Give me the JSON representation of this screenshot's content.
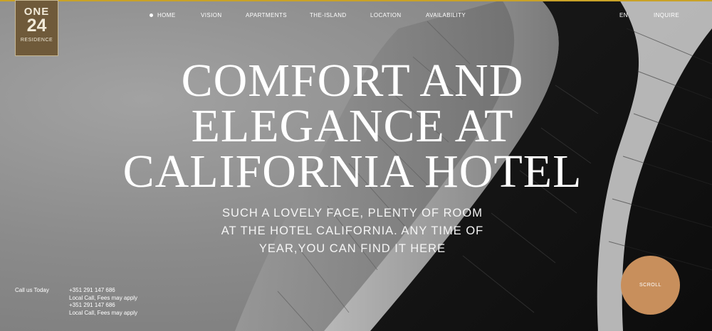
{
  "logo": {
    "line1": "ONE",
    "line2": "24",
    "line3": "RESIDENCE"
  },
  "nav": {
    "home": "HOME",
    "vision": "VISION",
    "apartments": "APARTMENTS",
    "island": "THE-ISLAND",
    "location": "LOCATION",
    "availability": "AVAILABILITY",
    "language": "EN",
    "inquire": "INQUIRE"
  },
  "hero": {
    "title_lines": [
      "COMFORT AND",
      "ELEGANCE AT",
      "CALIFORNIA HOTEL"
    ],
    "subtitle_lines": [
      "SUCH A LOVELY FACE, PLENTY OF ROOM",
      "AT THE HOTEL CALIFORNIA. ANY TIME OF",
      "YEAR,YOU CAN FIND IT HERE"
    ]
  },
  "contact": {
    "label": "Call us Today",
    "lines": [
      "+351 291 147 686",
      "Local Call, Fees may apply",
      "+351 291 147 686",
      "Local Call, Fees may apply"
    ]
  },
  "scroll": {
    "label": "SCROLL"
  },
  "colors": {
    "accent": "#c9a227",
    "logo_bg": "#6f5a3a",
    "scroll_bg": "#c88f5c"
  }
}
